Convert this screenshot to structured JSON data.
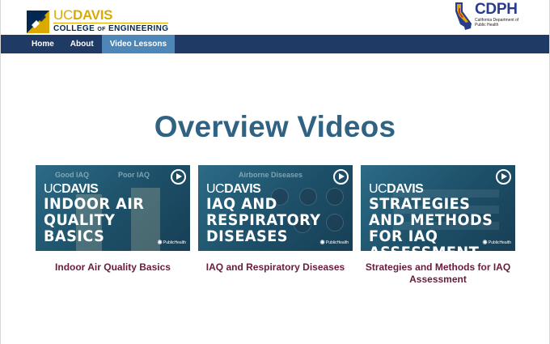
{
  "header": {
    "ucdavis_logo": {
      "uc": "UC",
      "davis": "DAVIS",
      "college_pre": "COLLEGE ",
      "college_of": "OF",
      "college_post": " ENGINEERING"
    },
    "cdph_logo": {
      "name": "CDPH",
      "subtitle": "California Department of Public Health"
    }
  },
  "nav": {
    "items": [
      {
        "label": "Home",
        "active": false
      },
      {
        "label": "About",
        "active": false
      },
      {
        "label": "Video Lessons",
        "active": true
      }
    ]
  },
  "page": {
    "title": "Overview Videos"
  },
  "videos": [
    {
      "thumb_brand_uc": "UC",
      "thumb_brand_davis": "DAVIS",
      "thumb_title": "INDOOR AIR QUALITY BASICS",
      "thumb_labels": [
        "Good IAQ",
        "Poor IAQ"
      ],
      "thumb_badge": "PublicHealth",
      "caption": "Indoor Air Quality Basics"
    },
    {
      "thumb_brand_uc": "UC",
      "thumb_brand_davis": "DAVIS",
      "thumb_title": "IAQ AND RESPIRATORY DISEASES",
      "thumb_labels": [
        "Airborne Diseases"
      ],
      "thumb_badge": "PublicHealth",
      "caption": "IAQ and Respiratory Diseases"
    },
    {
      "thumb_brand_uc": "UC",
      "thumb_brand_davis": "DAVIS",
      "thumb_title": "STRATEGIES AND METHODS FOR IAQ ASSESSMENT",
      "thumb_labels": [],
      "thumb_badge": "PublicHealth",
      "caption": "Strategies and Methods for IAQ Assessment"
    }
  ],
  "colors": {
    "nav_bg": "#1f3a64",
    "nav_active": "#4f86b8",
    "title": "#2f6283",
    "caption": "#6a1b3d",
    "ucd_gold": "#daaa00",
    "ucd_blue": "#022851"
  }
}
